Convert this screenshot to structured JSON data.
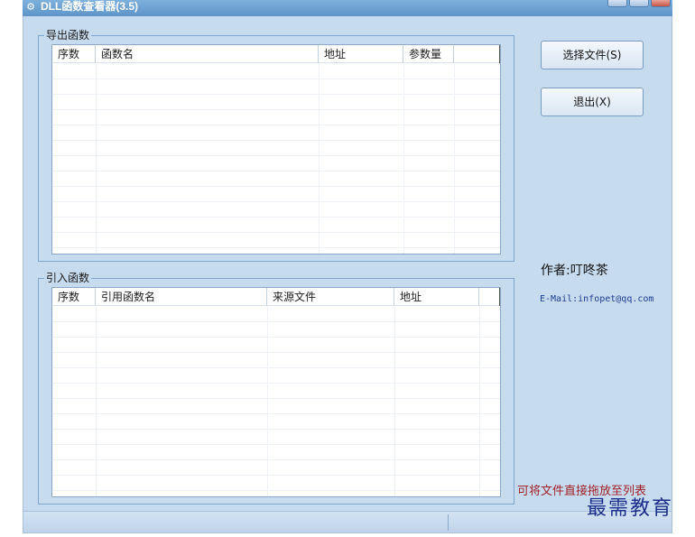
{
  "window": {
    "title": "DLL函数查看器(3.5)",
    "title_icon": "app-icon"
  },
  "exports": {
    "group_label": "导出函数",
    "columns": [
      "序数",
      "函数名",
      "地址",
      "参数量"
    ]
  },
  "imports": {
    "group_label": "引入函数",
    "columns": [
      "序数",
      "引用函数名",
      "来源文件",
      "地址"
    ]
  },
  "buttons": {
    "select_file": "选择文件(S)",
    "exit": "退出(X)"
  },
  "info": {
    "author": "作者:叮咚茶",
    "email": "E-Mail:infopet@qq.com",
    "drag_hint": "可将文件直接拖放至列表"
  },
  "watermark": "最需教育",
  "colors": {
    "client_bg": "#c7dbef",
    "hint_text": "#a0222a",
    "email_text": "#1c3c8e"
  }
}
